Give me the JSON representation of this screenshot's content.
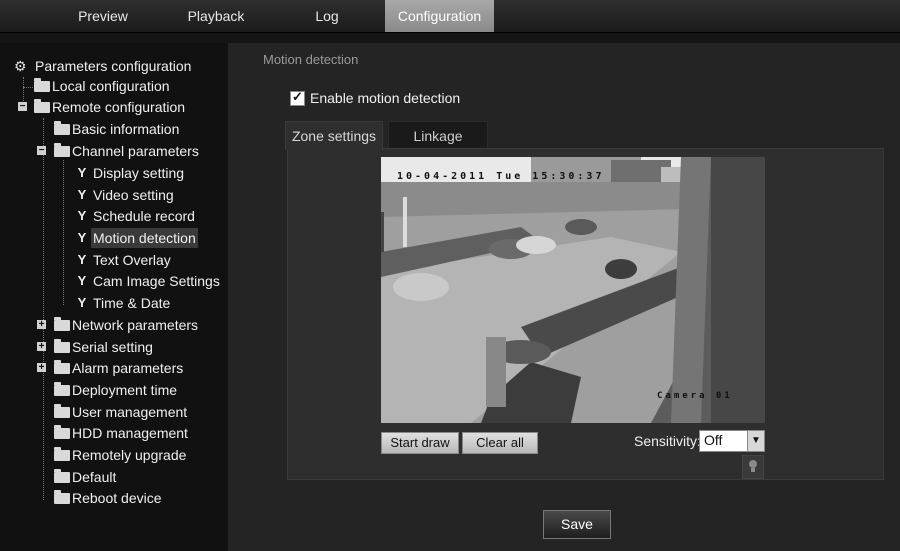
{
  "nav": {
    "tabs": [
      {
        "label": "Preview"
      },
      {
        "label": "Playback"
      },
      {
        "label": "Log"
      },
      {
        "label": "Configuration"
      }
    ],
    "active_tab": "Configuration"
  },
  "sidebar": {
    "root": "Parameters configuration",
    "items": [
      {
        "label": "Local configuration"
      },
      {
        "label": "Remote configuration"
      },
      {
        "label": "Basic information"
      },
      {
        "label": "Channel parameters"
      },
      {
        "label": "Display setting"
      },
      {
        "label": "Video setting"
      },
      {
        "label": "Schedule record"
      },
      {
        "label": "Motion detection"
      },
      {
        "label": "Text Overlay"
      },
      {
        "label": "Cam Image Settings"
      },
      {
        "label": "Time & Date"
      },
      {
        "label": "Network parameters"
      },
      {
        "label": "Serial setting"
      },
      {
        "label": "Alarm parameters"
      },
      {
        "label": "Deployment time"
      },
      {
        "label": "User management"
      },
      {
        "label": "HDD management"
      },
      {
        "label": "Remotely upgrade"
      },
      {
        "label": "Default"
      },
      {
        "label": "Reboot device"
      }
    ]
  },
  "main": {
    "section_title": "Motion detection",
    "enable_label": "Enable motion detection",
    "enable_checked": true,
    "tabs": [
      {
        "label": "Zone settings"
      },
      {
        "label": "Linkage"
      }
    ],
    "video": {
      "timestamp": "10-04-2011 Tue 15:30:37",
      "camera_label": "Camera 01"
    },
    "start_draw_label": "Start draw",
    "clear_all_label": "Clear all",
    "sensitivity_label": "Sensitivity:",
    "sensitivity_value": "Off",
    "save_label": "Save"
  },
  "icons": {
    "root": "config-root-icon",
    "folder": "folder-icon",
    "leaf": "wrench-icon",
    "expand": "expand-icon",
    "collapse": "collapse-icon",
    "dropdown": "chevron-down-icon",
    "help": "lightbulb-icon"
  }
}
